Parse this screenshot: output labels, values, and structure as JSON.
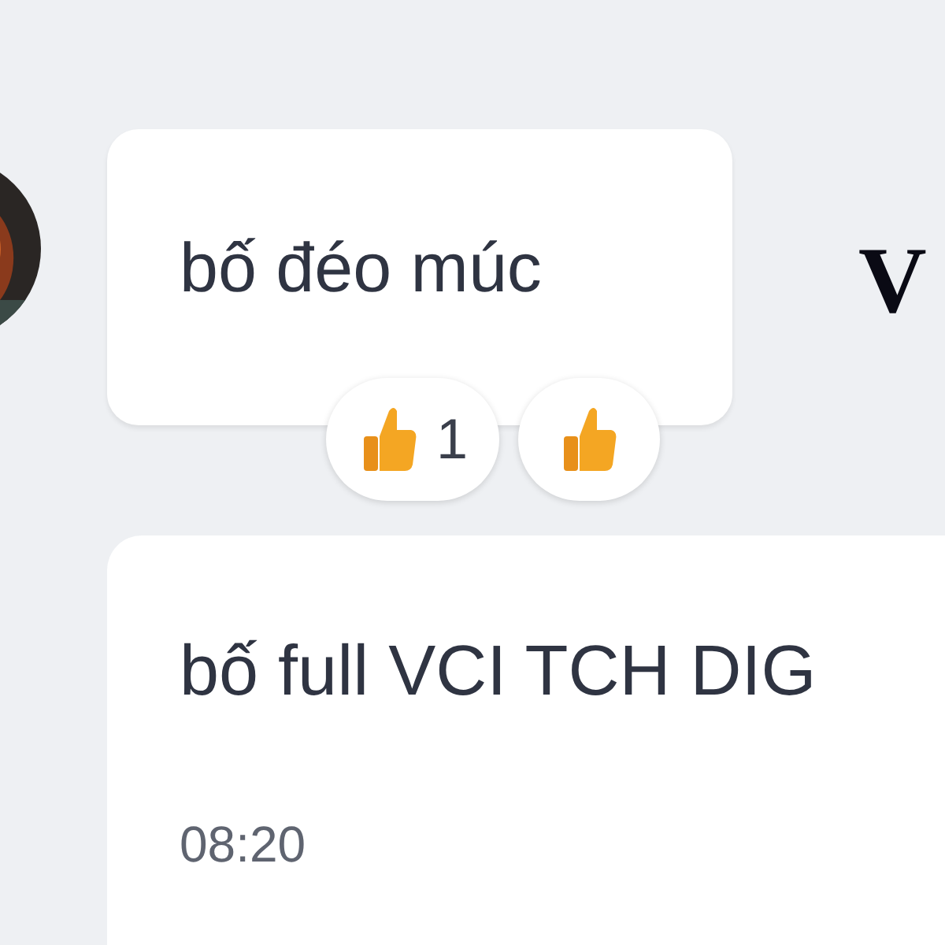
{
  "messages": [
    {
      "text": "bố đéo múc",
      "reactions": [
        {
          "kind": "count",
          "count": "1"
        },
        {
          "kind": "plain"
        }
      ],
      "side_text": "V"
    },
    {
      "text": "bố full VCI TCH DIG",
      "time": "08:20"
    }
  ]
}
